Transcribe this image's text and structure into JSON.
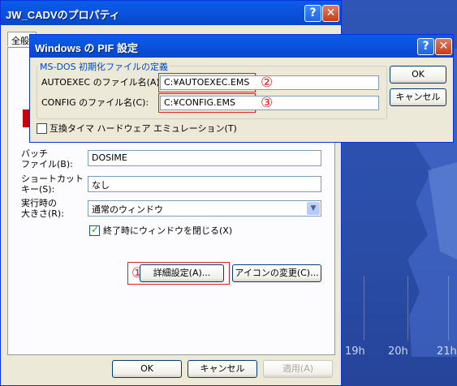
{
  "outer": {
    "title": "JW_CADVのプロパティ",
    "tab_general": "全般",
    "batch_label_1": "バッチ",
    "batch_label_2": "ファイル(B):",
    "batch_value": "DOSIME",
    "shortcut_label_1": "ショートカット",
    "shortcut_label_2": "キー(S):",
    "shortcut_value": "なし",
    "run_label_1": "実行時の",
    "run_label_2": "大きさ(R):",
    "run_value": "通常のウィンドウ",
    "close_on_exit_label": "終了時にウィンドウを閉じる(X)",
    "close_on_exit_checked": true,
    "advanced_button": "詳細設定(A)...",
    "change_icon_button": "アイコンの変更(C)...",
    "ok_button": "OK",
    "cancel_button": "キャンセル",
    "apply_button": "適用(A)",
    "annotation_1": "①"
  },
  "pif": {
    "title": "Windows の PIF 設定",
    "group_label": "MS-DOS 初期化ファイルの定義",
    "autoexec_label": "AUTOEXEC のファイル名(A):",
    "autoexec_value": "C:¥AUTOEXEC.EMS",
    "config_label": "CONFIG のファイル名(C):",
    "config_value": "C:¥CONFIG.EMS",
    "compat_timer_label": "互換タイマ ハードウェア エミュレーション(T)",
    "compat_timer_checked": false,
    "ok_button": "OK",
    "cancel_button": "キャンセル",
    "annotation_2": "②",
    "annotation_3": "③"
  },
  "desktop": {
    "time_labels": [
      "19h",
      "20h",
      "21h"
    ]
  }
}
